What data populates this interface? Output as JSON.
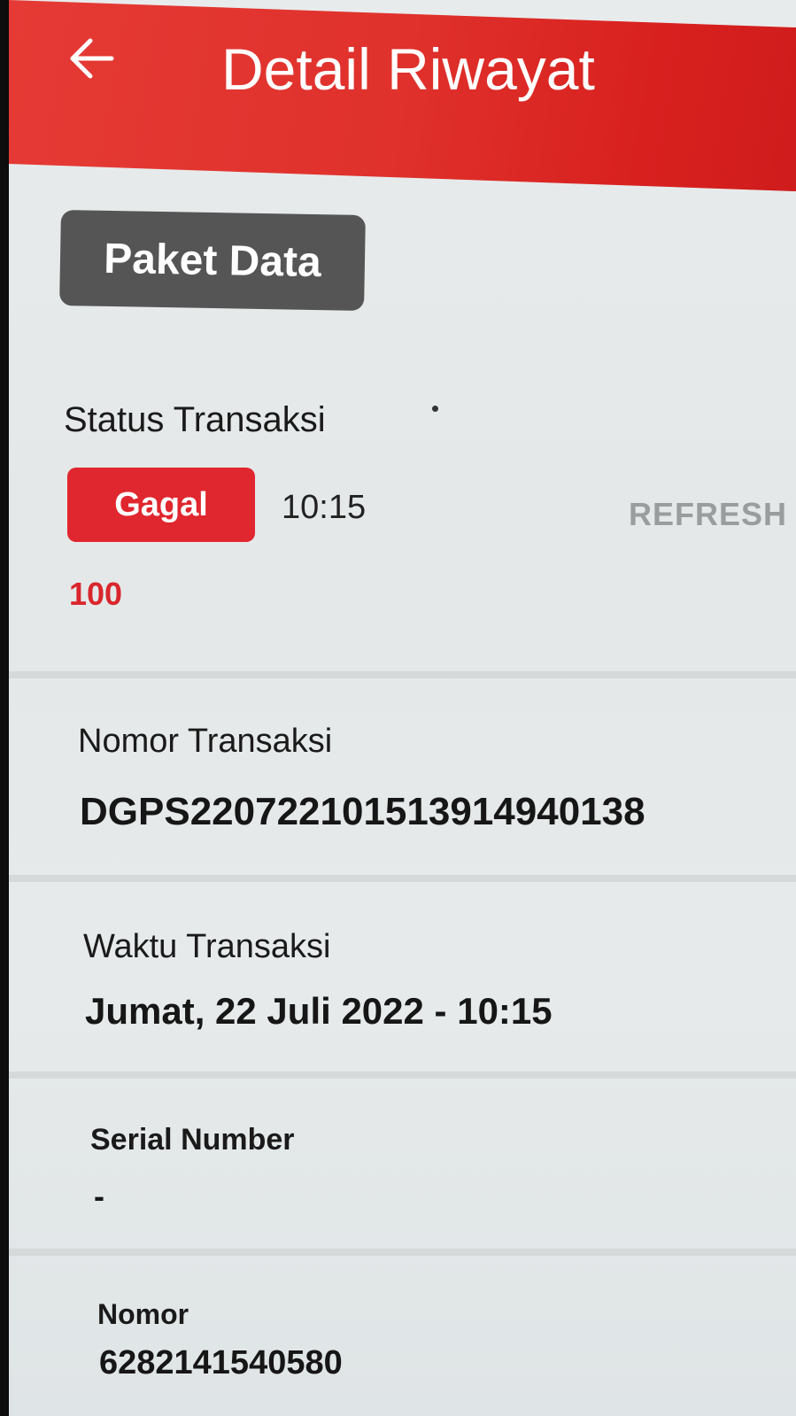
{
  "appbar": {
    "title": "Detail Riwayat",
    "back_icon": "arrow-left-icon"
  },
  "category": "Paket Data",
  "status": {
    "label": "Status Transaksi",
    "badge": "Gagal",
    "time": "10:15",
    "refresh_label": "REFRESH",
    "code": "100"
  },
  "transaction_number": {
    "label": "Nomor Transaksi",
    "value": "DGPS22072210151391494013​8"
  },
  "transaction_time": {
    "label": "Waktu Transaksi",
    "value": "Jumat, 22 Juli 2022 - 10:15"
  },
  "serial_number": {
    "label": "Serial Number",
    "value": "-"
  },
  "phone_number": {
    "label": "Nomor",
    "value": "6282141540580"
  },
  "colors": {
    "appbar": "#e0312c",
    "fail_badge": "#e0262e",
    "chip": "#555555"
  }
}
